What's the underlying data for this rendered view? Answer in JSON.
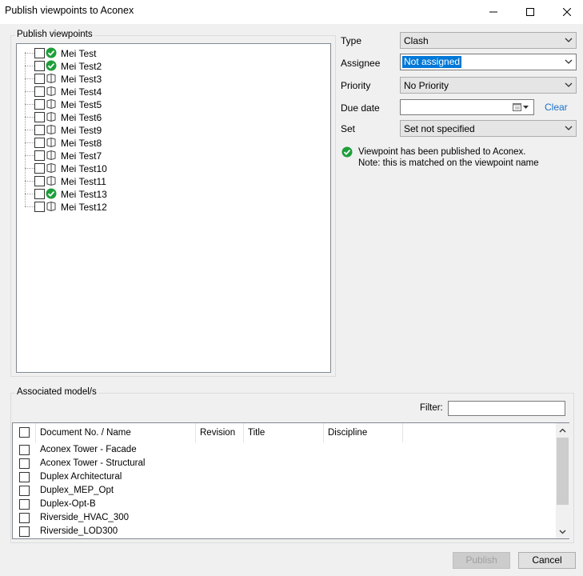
{
  "window": {
    "title": "Publish viewpoints to Aconex"
  },
  "publish_group": {
    "label": "Publish viewpoints",
    "items": [
      {
        "label": "Mei Test",
        "status": "published"
      },
      {
        "label": "Mei Test2",
        "status": "published"
      },
      {
        "label": "Mei Test3",
        "status": "viewpoint"
      },
      {
        "label": "Mei Test4",
        "status": "viewpoint"
      },
      {
        "label": "Mei Test5",
        "status": "viewpoint"
      },
      {
        "label": "Mei Test6",
        "status": "viewpoint"
      },
      {
        "label": "Mei Test9",
        "status": "viewpoint"
      },
      {
        "label": "Mei Test8",
        "status": "viewpoint"
      },
      {
        "label": "Mei Test7",
        "status": "viewpoint"
      },
      {
        "label": "Mei Test10",
        "status": "viewpoint"
      },
      {
        "label": "Mei Test11",
        "status": "viewpoint"
      },
      {
        "label": "Mei Test13",
        "status": "published"
      },
      {
        "label": "Mei Test12",
        "status": "viewpoint"
      }
    ]
  },
  "form": {
    "type": {
      "label": "Type",
      "value": "Clash"
    },
    "assignee": {
      "label": "Assignee",
      "value": "Not assigned"
    },
    "priority": {
      "label": "Priority",
      "value": "No Priority"
    },
    "due_date": {
      "label": "Due date",
      "value": "",
      "clear_label": "Clear"
    },
    "set": {
      "label": "Set",
      "value": "Set not specified"
    }
  },
  "info": {
    "line1": "Viewpoint has been published to Aconex.",
    "line2": "Note: this is matched on the viewpoint name"
  },
  "models_group": {
    "label": "Associated model/s",
    "filter_label": "Filter:",
    "filter_value": "",
    "columns": [
      "Document No. / Name",
      "Revision",
      "Title",
      "Discipline"
    ],
    "rows": [
      {
        "name": "Aconex Tower - Facade"
      },
      {
        "name": "Aconex Tower - Structural"
      },
      {
        "name": "Duplex Architectural"
      },
      {
        "name": "Duplex_MEP_Opt"
      },
      {
        "name": "Duplex-Opt-B"
      },
      {
        "name": "Riverside_HVAC_300"
      },
      {
        "name": "Riverside_LOD300"
      }
    ]
  },
  "buttons": {
    "publish": "Publish",
    "cancel": "Cancel"
  },
  "colors": {
    "selection": "#0078d7",
    "link": "#1a6fc9",
    "success": "#1e9e3a"
  }
}
